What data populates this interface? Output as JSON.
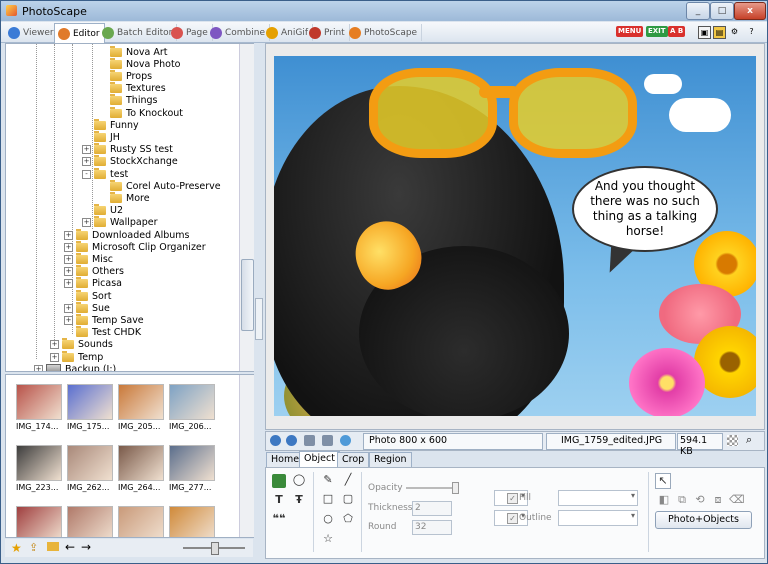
{
  "window": {
    "title": "PhotoScape",
    "minimize": "_",
    "maximize": "□",
    "close": "x"
  },
  "tabs": [
    {
      "label": "Viewer",
      "icon": "viewer-icon",
      "color": "#3b7bd6"
    },
    {
      "label": "Editor",
      "icon": "editor-icon",
      "color": "#e07a2a"
    },
    {
      "label": "Batch Editor",
      "icon": "batch-editor-icon",
      "color": "#6aa84f"
    },
    {
      "label": "Page",
      "icon": "page-icon",
      "color": "#d9534f"
    },
    {
      "label": "Combine",
      "icon": "combine-icon",
      "color": "#7e57c2"
    },
    {
      "label": "AniGif",
      "icon": "anigif-icon",
      "color": "#e5a000"
    },
    {
      "label": "Print",
      "icon": "print-icon",
      "color": "#c0392b"
    },
    {
      "label": "PhotoScape",
      "icon": "photoscape-icon",
      "color": "#e67e22"
    }
  ],
  "top_buttons": {
    "menu": "MENU",
    "exit": "EXIT",
    "lang": "A B"
  },
  "tree": {
    "items": [
      {
        "label": "Nova Art",
        "level": 3
      },
      {
        "label": "Nova Photo",
        "level": 3
      },
      {
        "label": "Props",
        "level": 3
      },
      {
        "label": "Textures",
        "level": 3
      },
      {
        "label": "Things",
        "level": 3
      },
      {
        "label": "To Knockout",
        "level": 3
      },
      {
        "label": "Funny",
        "level": 2
      },
      {
        "label": "JH",
        "level": 2
      },
      {
        "label": "Rusty SS test",
        "level": 2,
        "expander": "+"
      },
      {
        "label": "StockXchange",
        "level": 2,
        "expander": "+"
      },
      {
        "label": "test",
        "level": 2,
        "expander": "-"
      },
      {
        "label": "Corel Auto-Preserve",
        "level": 3
      },
      {
        "label": "More",
        "level": 3
      },
      {
        "label": "U2",
        "level": 2
      },
      {
        "label": "Wallpaper",
        "level": 2,
        "expander": "+"
      },
      {
        "label": "Downloaded Albums",
        "level": 1,
        "expander": "+"
      },
      {
        "label": "Microsoft Clip Organizer",
        "level": 1,
        "expander": "+"
      },
      {
        "label": "Misc",
        "level": 1,
        "expander": "+"
      },
      {
        "label": "Others",
        "level": 1,
        "expander": "+"
      },
      {
        "label": "Picasa",
        "level": 1,
        "expander": "+"
      },
      {
        "label": "Sort",
        "level": 1
      },
      {
        "label": "Sue",
        "level": 1,
        "expander": "+"
      },
      {
        "label": "Temp Save",
        "level": 1,
        "expander": "+"
      },
      {
        "label": "Test CHDK",
        "level": 1
      },
      {
        "label": "Sounds",
        "level": 0,
        "expander": "+"
      },
      {
        "label": "Temp",
        "level": 0,
        "expander": "+"
      },
      {
        "label": "Backup (I:)",
        "level": -1,
        "expander": "+",
        "drive": true
      }
    ]
  },
  "thumbnails": [
    {
      "caption": "IMG_174...",
      "color": "#b8534a"
    },
    {
      "caption": "IMG_175...",
      "color": "#5a6fd0"
    },
    {
      "caption": "IMG_205...",
      "color": "#c9793a"
    },
    {
      "caption": "IMG_206...",
      "color": "#7ea2c4"
    },
    {
      "caption": "IMG_223...",
      "color": "#3d3d3d"
    },
    {
      "caption": "IMG_262...",
      "color": "#a9897a"
    },
    {
      "caption": "IMG_264...",
      "color": "#7a5a4a"
    },
    {
      "caption": "IMG_277...",
      "color": "#5b6e8c"
    },
    {
      "caption": "",
      "color": "#a04040"
    },
    {
      "caption": "",
      "color": "#b07a6a"
    },
    {
      "caption": "",
      "color": "#c99a7a"
    },
    {
      "caption": "",
      "color": "#d08a3a"
    }
  ],
  "speech_bubble": "And you thought there was no such thing as a talking horse!",
  "infobar": {
    "photo_size": "Photo 800 x 600",
    "filename": "IMG_1759_edited.JPG",
    "filesize": "594.1 KB"
  },
  "editor_tabs": [
    "Home",
    "Object",
    "Crop",
    "Region"
  ],
  "object_panel": {
    "opacity_label": "Opacity",
    "thickness_label": "Thickness",
    "thickness_value": "2",
    "round_label": "Round",
    "round_value": "32",
    "fill_label": "Fill",
    "outline_label": "Outline",
    "photo_objects_button": "Photo+Objects",
    "text_tool_glyph": "T",
    "text_tool2_glyph": "Ŧ",
    "quote_glyph": "❝❝"
  }
}
